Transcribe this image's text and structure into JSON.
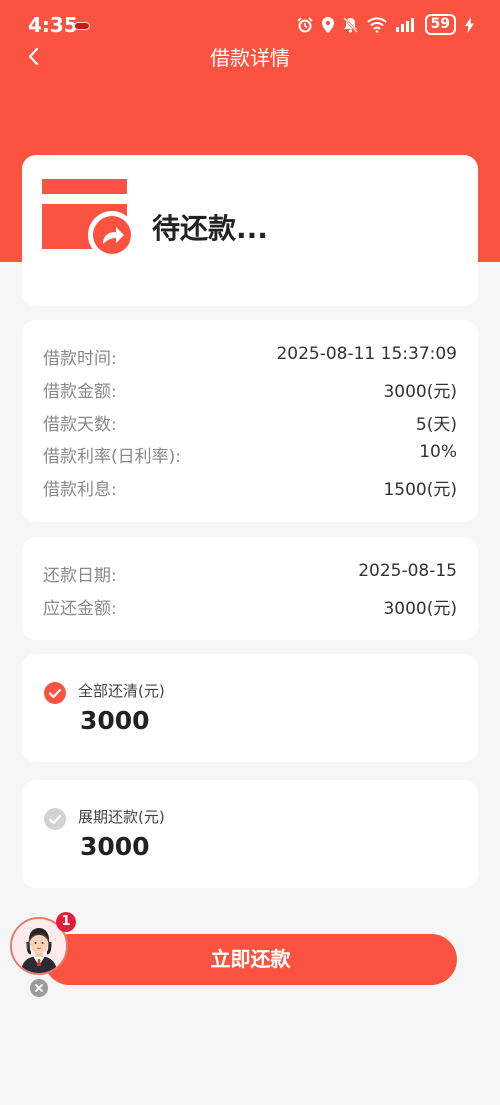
{
  "status_bar": {
    "time": "4:35",
    "battery": "59",
    "icons": [
      "alarm-icon",
      "location-icon",
      "mute-icon",
      "wifi-icon",
      "signal-icon",
      "battery-icon",
      "charging-icon"
    ]
  },
  "nav": {
    "title": "借款详情",
    "back_icon": "chevron-left-icon"
  },
  "loan_status": {
    "text": "待还款...",
    "icon": "card-arrow-icon"
  },
  "loan_info": [
    {
      "label": "借款时间:",
      "value": "2025-08-11 15:37:09"
    },
    {
      "label": "借款金额:",
      "value": "3000(元)"
    },
    {
      "label": "借款天数:",
      "value": "5(天)"
    },
    {
      "label": "借款利率(日利率):",
      "value": "10%"
    },
    {
      "label": "借款利息:",
      "value": "1500(元)"
    }
  ],
  "repay_info": [
    {
      "label": "还款日期:",
      "value": "2025-08-15"
    },
    {
      "label": "应还金额:",
      "value": "3000(元)"
    }
  ],
  "options": [
    {
      "label": "全部还清(元)",
      "amount": "3000",
      "selected": true
    },
    {
      "label": "展期还款(元)",
      "amount": "3000",
      "selected": false
    }
  ],
  "pay_button": "立即还款",
  "support": {
    "badge": "1",
    "icon": "customer-service-avatar-icon"
  },
  "colors": {
    "accent": "#fa5341",
    "background": "#f6f6f6",
    "card": "#ffffff"
  }
}
